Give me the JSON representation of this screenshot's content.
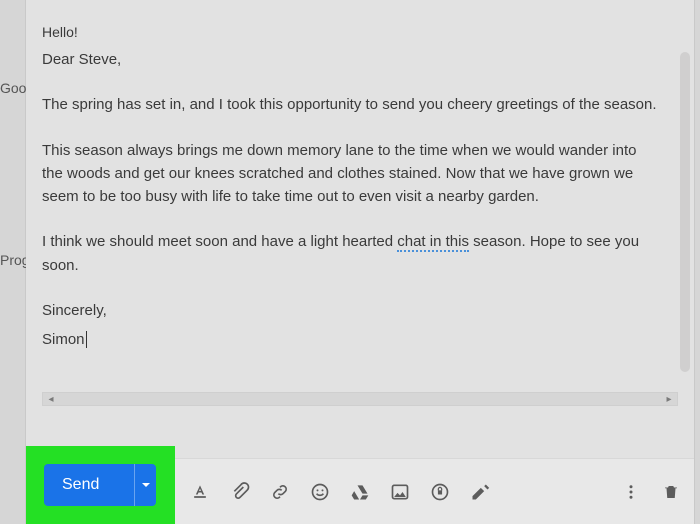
{
  "background": {
    "frag1": "Goo",
    "frag2": "Prog"
  },
  "compose": {
    "subject": "Hello!",
    "body": {
      "salutation": "Dear Steve,",
      "p1": "The spring has set in, and I took this opportunity to send you cheery greetings of the season.",
      "p2": "This season always brings me down memory lane to the time when we would wander into the woods and get our knees scratched and clothes stained. Now that we have grown we seem to be too busy with life to take time out to even visit a nearby garden.",
      "p3a": "I think we should meet soon and have a light hearted ",
      "p3_squiggle": "chat in this",
      "p3b": " season. Hope to see you soon.",
      "signoff": "Sincerely,",
      "signature": "Simon"
    }
  },
  "toolbar": {
    "send_label": "Send"
  }
}
